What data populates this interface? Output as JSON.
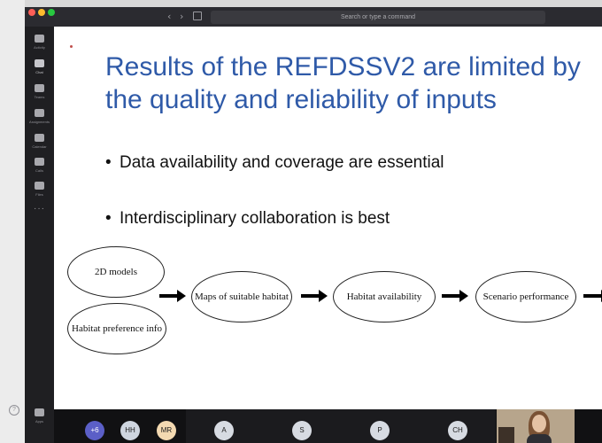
{
  "window": {
    "search_placeholder": "Search or type a command",
    "nav_back": "‹",
    "nav_forward": "›"
  },
  "appbar": {
    "items": [
      {
        "label": "Activity",
        "icon": "bell-icon"
      },
      {
        "label": "Chat",
        "icon": "chat-icon"
      },
      {
        "label": "Teams",
        "icon": "teams-icon"
      },
      {
        "label": "Assignments",
        "icon": "assignments-icon"
      },
      {
        "label": "Calendar",
        "icon": "calendar-icon"
      },
      {
        "label": "Calls",
        "icon": "phone-icon"
      },
      {
        "label": "Files",
        "icon": "files-icon"
      }
    ],
    "more": "···",
    "bottom_items": [
      {
        "label": "Apps",
        "icon": "apps-icon"
      }
    ],
    "help": "?"
  },
  "slide": {
    "title": "Results of the REFDSSV2 are limited by the quality and reliability of inputs",
    "bullets": [
      "Data availability and coverage are essential",
      "Interdisciplinary collaboration is best"
    ],
    "bullet_mark": "•",
    "flow": {
      "node_2d_models": "2D models",
      "node_habitat_pref": "Habitat preference info",
      "node_maps": "Maps of suitable habitat",
      "node_availability": "Habitat availability",
      "node_scenario": "Scenario performance"
    },
    "accent_color": "#2f5aa8",
    "bullet_dot_color": "#c0504d"
  },
  "participants": {
    "overflow": "+6",
    "avatars": [
      {
        "initials": "HH",
        "color": "#cfd6e0"
      },
      {
        "initials": "MR",
        "color": "#f3d9b1"
      },
      {
        "initials": "A",
        "color": "#d7dbe2"
      },
      {
        "initials": "S",
        "color": "#d7dbe2"
      },
      {
        "initials": "P",
        "color": "#d7dbe2"
      },
      {
        "initials": "CH",
        "color": "#d7dbe2"
      }
    ],
    "overflow_color": "#5b5fc7"
  }
}
